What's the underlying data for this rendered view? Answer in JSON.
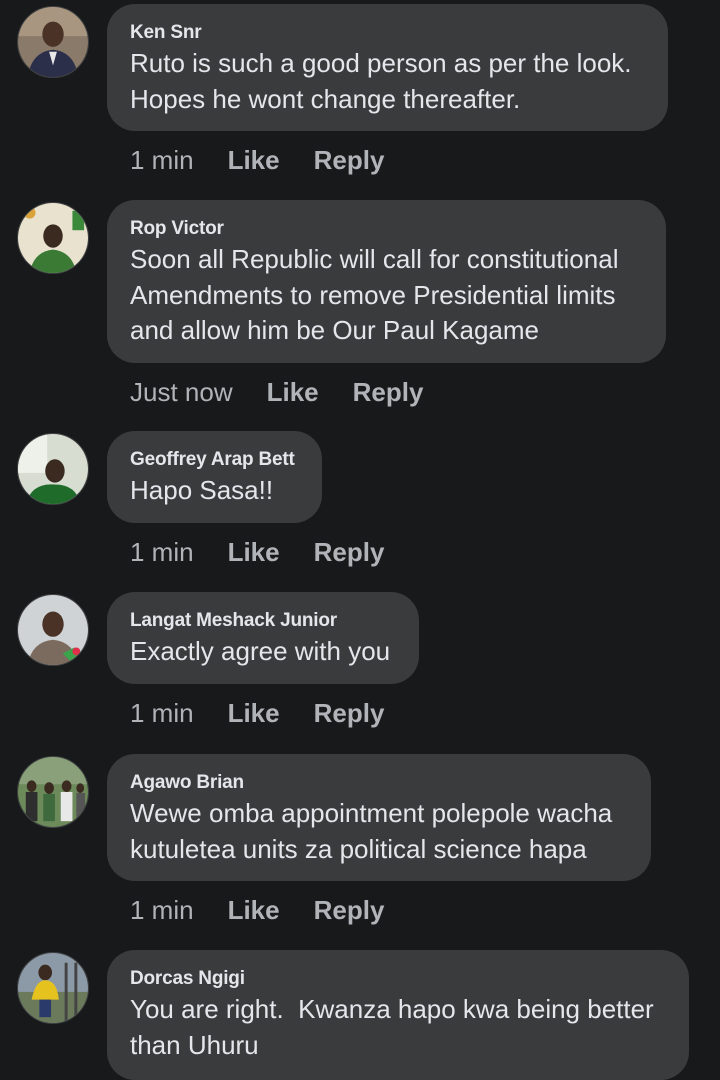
{
  "comments": [
    {
      "author": "Ken Snr",
      "text": "Ruto is such a good person as per the look.\nHopes he wont change thereafter.",
      "time": "1 min",
      "like_label": "Like",
      "reply_label": "Reply",
      "avatar_colors": {
        "bg": "#8a7a6a",
        "shirt": "#2b2f4a",
        "face": "#4a3326"
      }
    },
    {
      "author": "Rop Victor",
      "text": "Soon all Republic will call for constitutional\nAmendments to remove Presidential limits\nand allow him be Our Paul Kagame",
      "time": "Just now",
      "like_label": "Like",
      "reply_label": "Reply",
      "avatar_colors": {
        "bg": "#e8e2cf",
        "shirt": "#3b7a35",
        "face": "#3a2a20"
      }
    },
    {
      "author": "Geoffrey Arap Bett",
      "text": "Hapo Sasa!!",
      "time": "1 min",
      "like_label": "Like",
      "reply_label": "Reply",
      "avatar_colors": {
        "bg": "#d8ddd2",
        "shirt": "#1f6b2a",
        "face": "#3a2a1f"
      }
    },
    {
      "author": "Langat Meshack Junior",
      "text": "Exactly agree with you",
      "time": "1 min",
      "like_label": "Like",
      "reply_label": "Reply",
      "avatar_colors": {
        "bg": "#cfd3d6",
        "shirt": "#7b6a5e",
        "face": "#4a3326"
      }
    },
    {
      "author": "Agawo Brian",
      "text": "Wewe omba appointment polepole wacha\nkutuletea units za political science hapa",
      "time": "1 min",
      "like_label": "Like",
      "reply_label": "Reply",
      "avatar_colors": {
        "bg": "#6d8a5a",
        "shirt": "#3e3e3e",
        "face": "#3a2a20"
      }
    },
    {
      "author": "Dorcas Ngigi",
      "text": "You are right.  Kwanza hapo kwa being better\nthan Uhuru",
      "time": "",
      "like_label": "",
      "reply_label": "",
      "avatar_colors": {
        "bg": "#8c9aa8",
        "shirt": "#e6c21f",
        "face": "#3a2a20"
      }
    }
  ]
}
